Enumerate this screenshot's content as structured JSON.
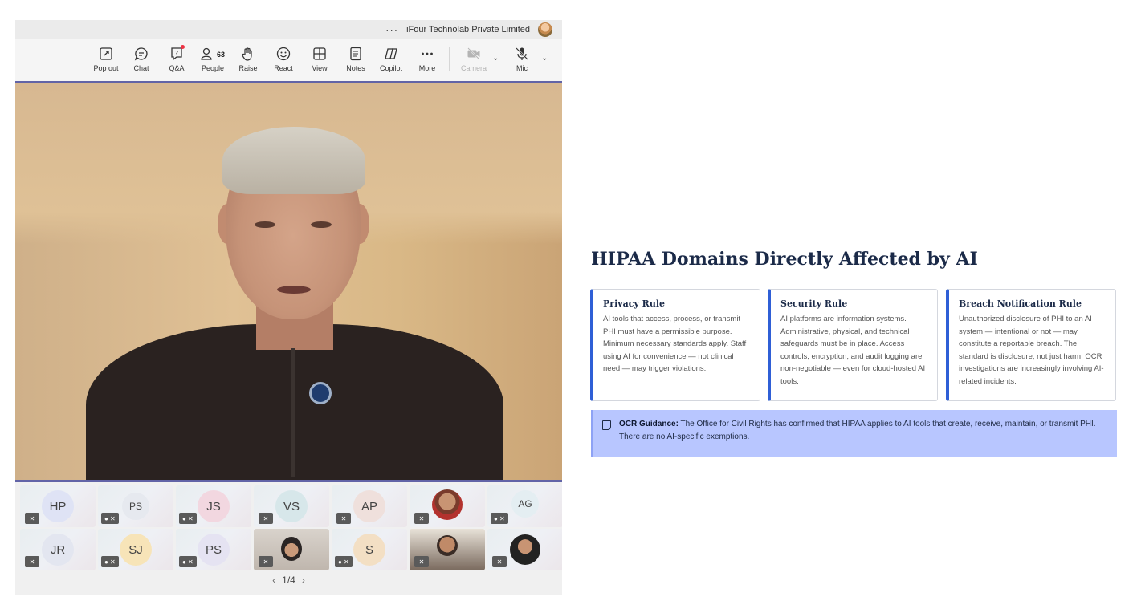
{
  "window": {
    "org_name": "iFour Technolab Private Limited",
    "more_dots": "···"
  },
  "toolbar": {
    "items": [
      {
        "label": "Pop out",
        "icon": "pop-out-icon"
      },
      {
        "label": "Chat",
        "icon": "chat-icon"
      },
      {
        "label": "Q&A",
        "icon": "qa-icon"
      },
      {
        "label": "People",
        "icon": "people-icon"
      },
      {
        "label": "Raise",
        "icon": "raise-hand-icon"
      },
      {
        "label": "React",
        "icon": "react-icon"
      },
      {
        "label": "View",
        "icon": "view-icon"
      },
      {
        "label": "Notes",
        "icon": "notes-icon"
      },
      {
        "label": "Copilot",
        "icon": "copilot-icon"
      },
      {
        "label": "More",
        "icon": "more-icon"
      },
      {
        "label": "Camera",
        "icon": "camera-off-icon"
      },
      {
        "label": "Mic",
        "icon": "mic-off-icon"
      }
    ],
    "people_count": "63"
  },
  "gallery": {
    "row1": [
      "HP",
      "PS",
      "JS",
      "VS",
      "AP",
      "",
      "AG"
    ],
    "row2": [
      "JR",
      "SJ",
      "PS",
      "",
      "S",
      "",
      ""
    ],
    "pager": "1/4"
  },
  "slide": {
    "title": "HIPAA Domains Directly Affected by AI",
    "cards": [
      {
        "title": "Privacy Rule",
        "body": "AI tools that access, process, or transmit PHI must have a permissible purpose. Minimum necessary standards apply. Staff using AI for convenience — not clinical need — may trigger violations."
      },
      {
        "title": "Security Rule",
        "body": "AI platforms are information systems. Administrative, physical, and technical safeguards must be in place. Access controls, encryption, and audit logging are non-negotiable — even for cloud-hosted AI tools."
      },
      {
        "title": "Breach Notification Rule",
        "body": "Unauthorized disclosure of PHI to an AI system — intentional or not — may constitute a reportable breach. The standard is disclosure, not just harm. OCR investigations are increasingly involving AI-related incidents."
      }
    ],
    "callout": {
      "label": "OCR Guidance:",
      "text": " The Office for Civil Rights has confirmed that HIPAA applies to AI tools that create, receive, maintain, or transmit PHI. There are no AI-specific exemptions."
    }
  },
  "colors": {
    "accent": "#2f5fd6",
    "callout_bg": "#b8c6ff",
    "teams_purple": "#6264a7",
    "title_navy": "#1b2a48"
  }
}
